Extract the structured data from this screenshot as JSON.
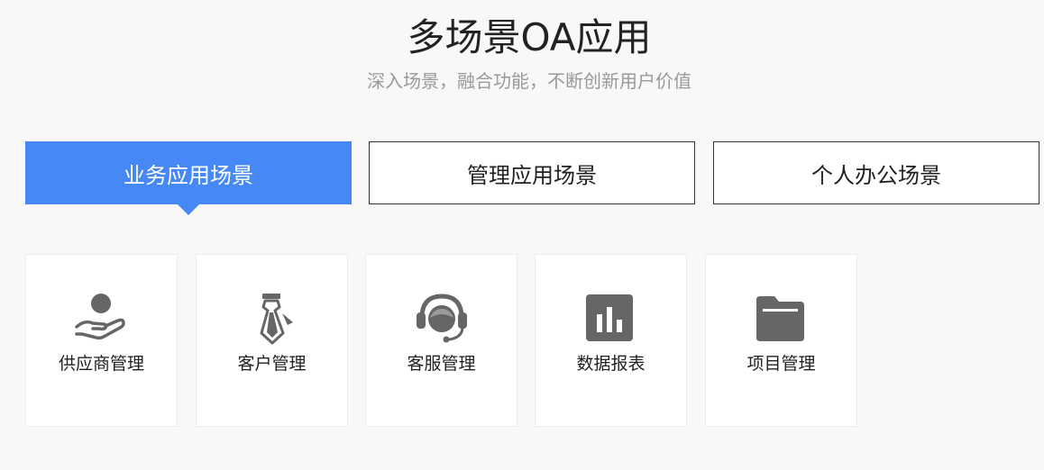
{
  "header": {
    "title": "多场景OA应用",
    "subtitle": "深入场景，融合功能，不断创新用户价值"
  },
  "tabs": [
    {
      "label": "业务应用场景",
      "active": true
    },
    {
      "label": "管理应用场景",
      "active": false
    },
    {
      "label": "个人办公场景",
      "active": false
    }
  ],
  "accent_color": "#4588f6",
  "icon_color": "#666666",
  "cards": [
    {
      "label": "供应商管理",
      "icon": "supplier-hand-person-icon"
    },
    {
      "label": "客户管理",
      "icon": "tie-icon"
    },
    {
      "label": "客服管理",
      "icon": "headset-agent-icon"
    },
    {
      "label": "数据报表",
      "icon": "bar-chart-icon"
    },
    {
      "label": "项目管理",
      "icon": "folder-icon"
    }
  ]
}
